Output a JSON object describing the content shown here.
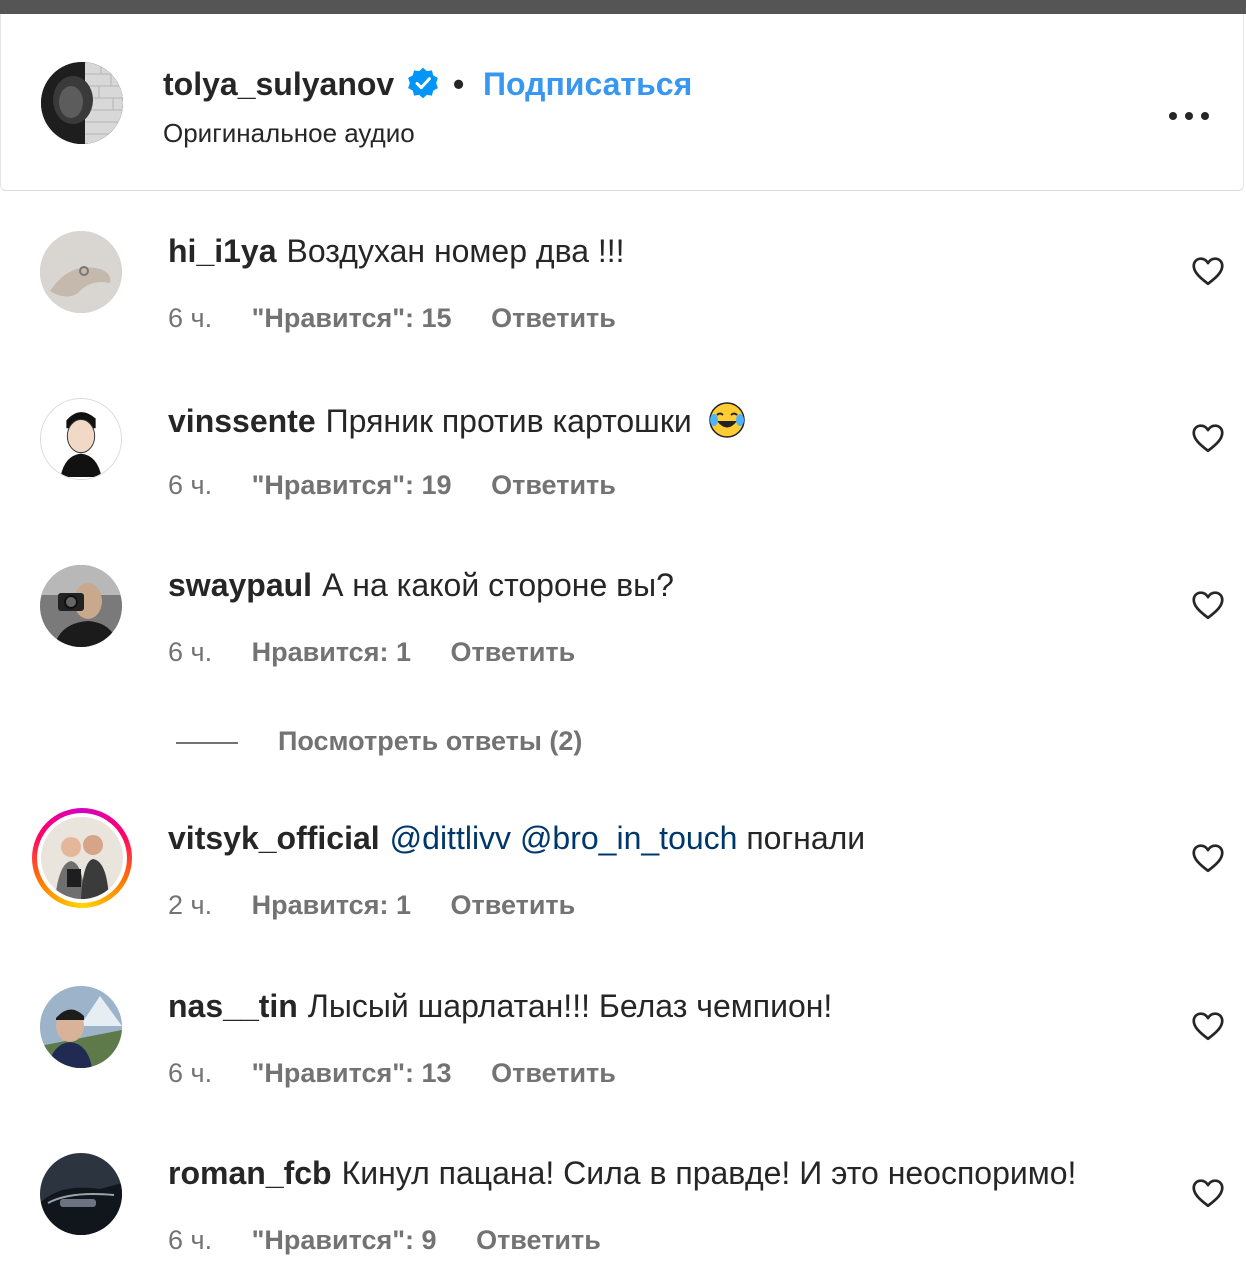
{
  "post": {
    "owner": "tolya_sulyanov",
    "separator": "•",
    "follow_label": "Подписаться",
    "audio_label": "Оригинальное аудио",
    "verified_icon": "verified-badge-icon",
    "accent_color": "#3897f0"
  },
  "comments": [
    {
      "user": "hi_i1ya",
      "text": "Воздухан номер два !!!",
      "time": "6 ч.",
      "likes": "\"Нравится\": 15",
      "reply": "Ответить"
    },
    {
      "user": "vinssente",
      "text": "Пряник против картошки",
      "emoji": "face-with-tears-of-joy-emoji",
      "time": "6 ч.",
      "likes": "\"Нравится\": 19",
      "reply": "Ответить"
    },
    {
      "user": "swaypaul",
      "text": "А на какой стороне вы?",
      "time": "6 ч.",
      "likes": "Нравится: 1",
      "reply": "Ответить"
    },
    {
      "user": "vitsyk_official",
      "mention1": "@dittlivv",
      "mention2": "@bro_in_touch",
      "text": "погнали",
      "time": "2 ч.",
      "likes": "Нравится: 1",
      "reply": "Ответить"
    },
    {
      "user": "nas__tin",
      "text": "Лысый шарлатан!!! Белаз чемпион!",
      "time": "6 ч.",
      "likes": "\"Нравится\": 13",
      "reply": "Ответить"
    },
    {
      "user": "roman_fcb",
      "text": "Кинул пацана! Сила в правде! И это неоспоримо!",
      "time": "6 ч.",
      "likes": "\"Нравится\": 9",
      "reply": "Ответить"
    }
  ],
  "view_replies_label": "Посмотреть ответы (2)"
}
